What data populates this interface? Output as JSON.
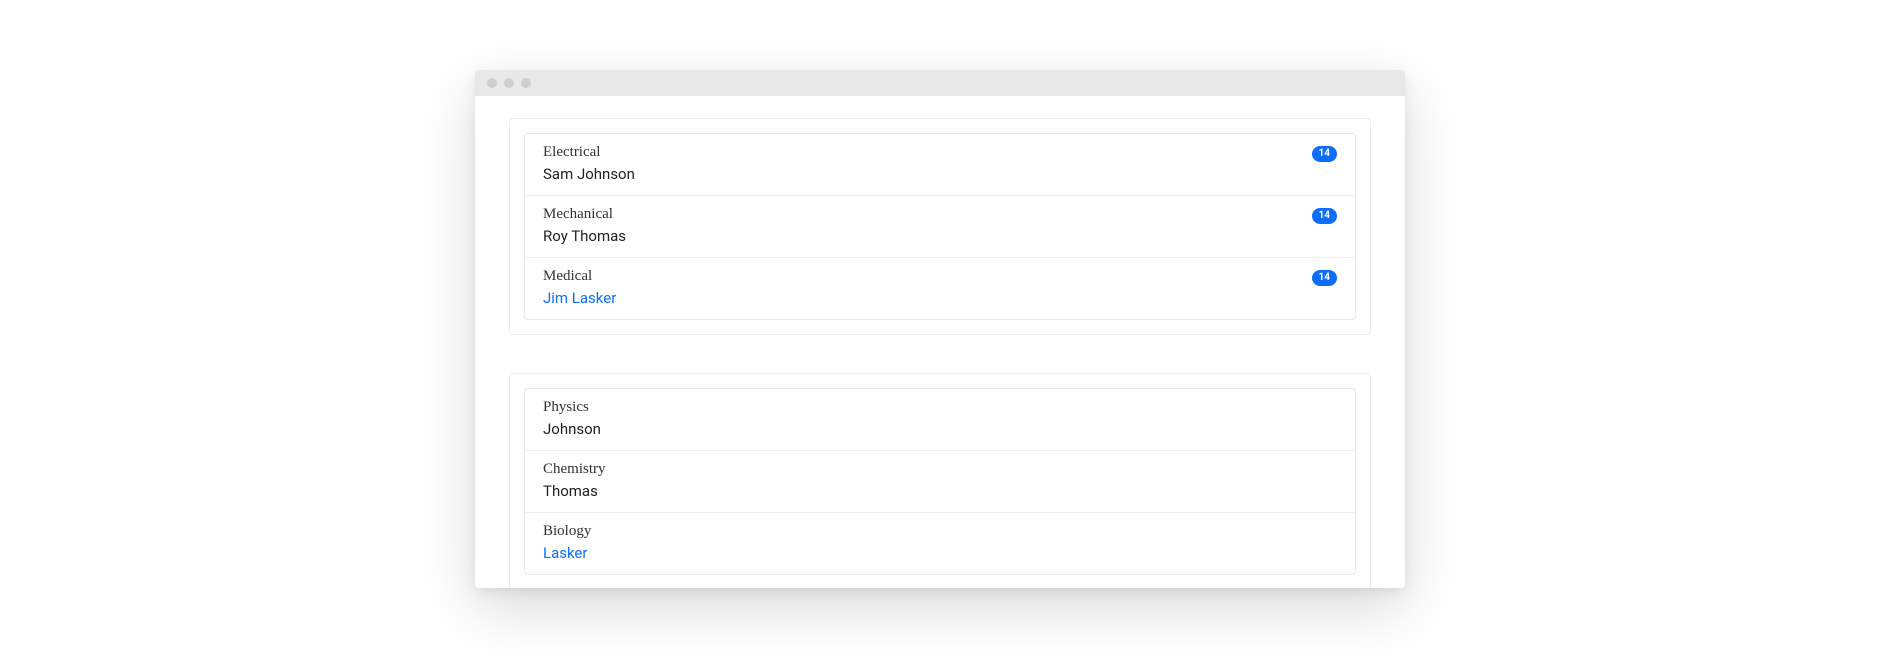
{
  "colors": {
    "badge_bg": "#0d6efd",
    "link": "#0d6efd"
  },
  "groups": [
    {
      "has_badges": true,
      "items": [
        {
          "title": "Electrical",
          "subtitle": "Sam Johnson",
          "badge": "14",
          "link_style": false
        },
        {
          "title": "Mechanical",
          "subtitle": "Roy Thomas",
          "badge": "14",
          "link_style": false
        },
        {
          "title": "Medical",
          "subtitle": "Jim Lasker",
          "badge": "14",
          "link_style": true
        }
      ]
    },
    {
      "has_badges": false,
      "items": [
        {
          "title": "Physics",
          "subtitle": "Johnson",
          "badge": null,
          "link_style": false
        },
        {
          "title": "Chemistry",
          "subtitle": "Thomas",
          "badge": null,
          "link_style": false
        },
        {
          "title": "Biology",
          "subtitle": "Lasker",
          "badge": null,
          "link_style": true
        }
      ]
    }
  ]
}
